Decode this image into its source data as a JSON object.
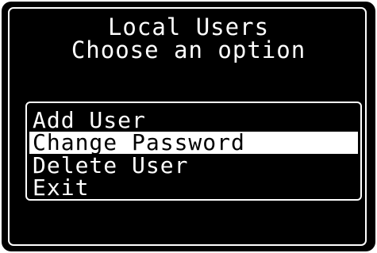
{
  "header": {
    "title": "Local Users",
    "subtitle": "Choose an option"
  },
  "menu": {
    "items": [
      {
        "label": "Add User"
      },
      {
        "label": "Change Password"
      },
      {
        "label": "Delete User"
      },
      {
        "label": "Exit"
      }
    ],
    "selected_label": "Change Password"
  },
  "colors": {
    "background": "#000000",
    "foreground": "#ffffff",
    "highlight_background": "#ffffff",
    "highlight_text": "#000000"
  }
}
